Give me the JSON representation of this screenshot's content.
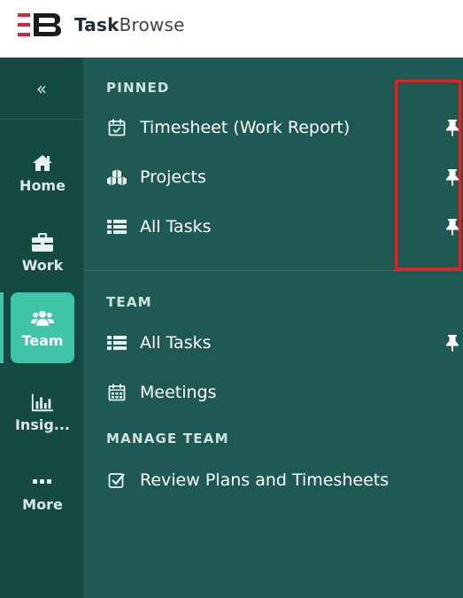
{
  "brand": {
    "name_bold": "Task",
    "name_light": "Browse"
  },
  "rail": {
    "collapse_label": "«",
    "items": [
      {
        "label": "Home",
        "icon": "home-icon"
      },
      {
        "label": "Work",
        "icon": "briefcase-icon"
      },
      {
        "label": "Team",
        "icon": "team-icon",
        "active": true
      },
      {
        "label": "Insig...",
        "icon": "insights-icon"
      },
      {
        "label": "More",
        "icon": "more-icon"
      }
    ]
  },
  "pinned": {
    "title": "PINNED",
    "items": [
      {
        "label": "Timesheet (Work Report)",
        "icon": "calendar-check-icon",
        "pinned": true
      },
      {
        "label": "Projects",
        "icon": "cubes-icon",
        "pinned": true
      },
      {
        "label": "All Tasks",
        "icon": "list-icon",
        "pinned": true
      }
    ]
  },
  "team": {
    "title": "TEAM",
    "items": [
      {
        "label": "All Tasks",
        "icon": "list-icon",
        "pinned": true
      },
      {
        "label": "Meetings",
        "icon": "calendar-icon",
        "pinned": false
      }
    ]
  },
  "manage_team": {
    "title": "MANAGE TEAM",
    "items": [
      {
        "label": "Review Plans and Timesheets",
        "icon": "check-square-icon"
      }
    ]
  },
  "colors": {
    "rail_bg": "#144a42",
    "panel_bg": "#1e5a53",
    "active_bg": "#3fc4a7",
    "highlight_border": "#d62828",
    "logo_red": "#d3263a"
  }
}
